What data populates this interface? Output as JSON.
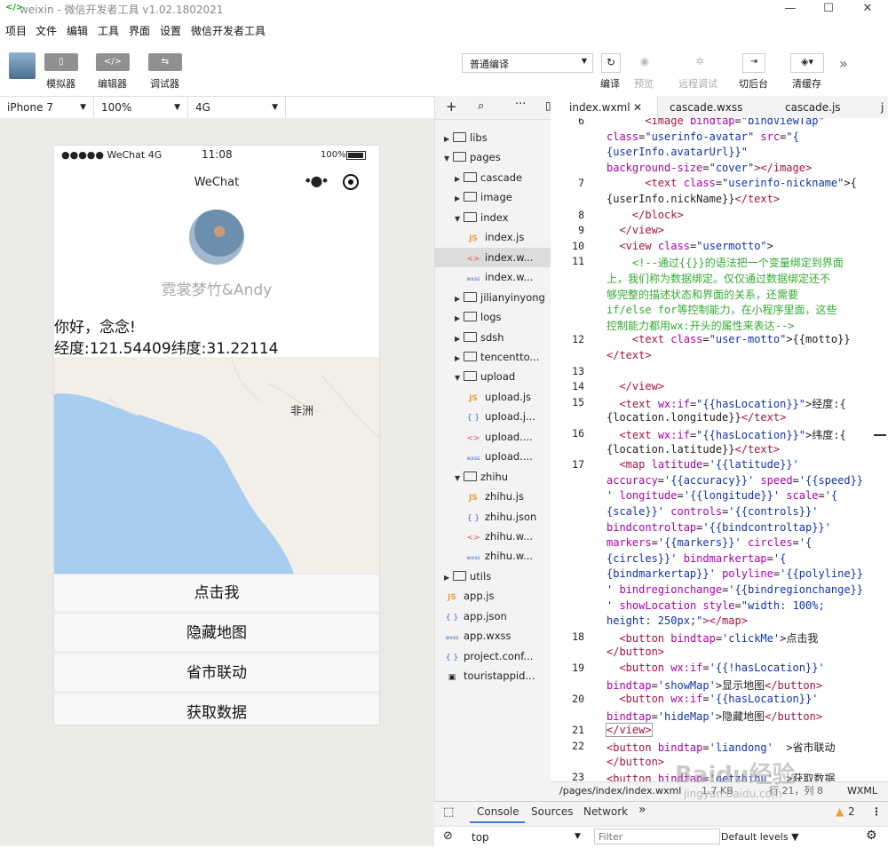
{
  "window": {
    "title": "weixin - 微信开发者工具 v1.02.1802021"
  },
  "menu": [
    "项目",
    "文件",
    "编辑",
    "工具",
    "界面",
    "设置",
    "微信开发者工具"
  ],
  "toolbar": {
    "simulator": "模拟器",
    "editor": "编辑器",
    "debugger": "调试器",
    "compile_mode": "普通编译",
    "compile": "编译",
    "preview": "预览",
    "remote_debug": "远程调试",
    "background": "切后台",
    "clear_cache": "清缓存"
  },
  "device": {
    "model": "iPhone 7",
    "zoom": "100%",
    "network": "4G"
  },
  "phone": {
    "status": {
      "carrier": "●●●●● WeChat 4G",
      "time": "11:08",
      "battery": "100%"
    },
    "nav_title": "WeChat",
    "nickname": "霓裳梦竹&Andy",
    "motto": "你好，念念!",
    "location": "经度:121.54409纬度:31.22114",
    "map_label": "非洲",
    "buttons": [
      "点击我",
      "隐藏地图",
      "省市联动",
      "获取数据"
    ]
  },
  "filetree": [
    {
      "depth": 0,
      "type": "folder",
      "open": false,
      "name": "libs"
    },
    {
      "depth": 0,
      "type": "folder",
      "open": true,
      "name": "pages"
    },
    {
      "depth": 1,
      "type": "folder",
      "open": false,
      "name": "cascade"
    },
    {
      "depth": 1,
      "type": "folder",
      "open": false,
      "name": "image"
    },
    {
      "depth": 1,
      "type": "folder",
      "open": true,
      "name": "index"
    },
    {
      "depth": 2,
      "type": "js",
      "name": "index.js"
    },
    {
      "depth": 2,
      "type": "xml",
      "name": "index.w...",
      "selected": true
    },
    {
      "depth": 2,
      "type": "wxss",
      "name": "index.w..."
    },
    {
      "depth": 1,
      "type": "folder",
      "open": false,
      "name": "jilianyinyong"
    },
    {
      "depth": 1,
      "type": "folder",
      "open": false,
      "name": "logs"
    },
    {
      "depth": 1,
      "type": "folder",
      "open": false,
      "name": "sdsh"
    },
    {
      "depth": 1,
      "type": "folder",
      "open": false,
      "name": "tencentto..."
    },
    {
      "depth": 1,
      "type": "folder",
      "open": true,
      "name": "upload"
    },
    {
      "depth": 2,
      "type": "js",
      "name": "upload.js"
    },
    {
      "depth": 2,
      "type": "json",
      "name": "upload.j..."
    },
    {
      "depth": 2,
      "type": "xml",
      "name": "upload...."
    },
    {
      "depth": 2,
      "type": "wxss",
      "name": "upload...."
    },
    {
      "depth": 1,
      "type": "folder",
      "open": true,
      "name": "zhihu"
    },
    {
      "depth": 2,
      "type": "js",
      "name": "zhihu.js"
    },
    {
      "depth": 2,
      "type": "json",
      "name": "zhihu.json"
    },
    {
      "depth": 2,
      "type": "xml",
      "name": "zhihu.w..."
    },
    {
      "depth": 2,
      "type": "wxss",
      "name": "zhihu.w..."
    },
    {
      "depth": 0,
      "type": "folder",
      "open": false,
      "name": "utils"
    },
    {
      "depth": 0,
      "type": "js",
      "name": "app.js"
    },
    {
      "depth": 0,
      "type": "json",
      "name": "app.json"
    },
    {
      "depth": 0,
      "type": "wxss",
      "name": "app.wxss"
    },
    {
      "depth": 0,
      "type": "json",
      "name": "project.conf..."
    },
    {
      "depth": 0,
      "type": "img",
      "name": "touristappid..."
    }
  ],
  "icon_labels": {
    "js": "JS",
    "xml": "<>",
    "wxss": "wxss",
    "json": "{ }",
    "img": "▣"
  },
  "tabs": [
    "index.wxml",
    "cascade.wxss",
    "cascade.js",
    "j"
  ],
  "code_lines": [
    {
      "n": "6",
      "html": "      <span class=\"tg\">&lt;image</span> <span class=\"at\">bindtap</span>=<span class=\"st\">\"bindViewTap\"</span>"
    },
    {
      "n": "",
      "html": "<span class=\"at\">class</span>=<span class=\"st\">\"userinfo-avatar\"</span> <span class=\"at\">src</span>=<span class=\"st\">\"{</span>"
    },
    {
      "n": "",
      "html": "<span class=\"st\">{userInfo.avatarUrl}}\"</span>"
    },
    {
      "n": "",
      "html": "<span class=\"at\">background-size</span>=<span class=\"st\">\"cover\"</span><span class=\"tg\">&gt;&lt;/image&gt;</span>"
    },
    {
      "n": "7",
      "html": "      <span class=\"tg\">&lt;text</span> <span class=\"at\">class</span>=<span class=\"st\">\"userinfo-nickname\"</span>&gt;{"
    },
    {
      "n": "",
      "html": "{userInfo.nickName}}<span class=\"tg\">&lt;/text&gt;</span>"
    },
    {
      "n": "8",
      "html": "    <span class=\"tg\">&lt;/block&gt;</span>"
    },
    {
      "n": "9",
      "html": "  <span class=\"tg\">&lt;/view&gt;</span>"
    },
    {
      "n": "10",
      "html": "  <span class=\"tg\">&lt;view</span> <span class=\"at\">class</span>=<span class=\"st\">\"usermotto\"</span>&gt;"
    },
    {
      "n": "11",
      "html": "    <span class=\"cm\">&lt;!--通过{{}}的语法把一个变量绑定到界面</span>"
    },
    {
      "n": "",
      "html": "<span class=\"cm\">上，我们称为数据绑定。仅仅通过数据绑定还不</span>"
    },
    {
      "n": "",
      "html": "<span class=\"cm\">够完整的描述状态和界面的关系，还需要</span>"
    },
    {
      "n": "",
      "html": "<span class=\"cm\">if/else for等控制能力，在小程序里面，这些</span>"
    },
    {
      "n": "",
      "html": "<span class=\"cm\">控制能力都用wx:开头的属性来表达--&gt;</span>"
    },
    {
      "n": "12",
      "html": "    <span class=\"tg\">&lt;text</span> <span class=\"at\">class</span>=<span class=\"st\">\"user-motto\"</span>&gt;{{motto}}"
    },
    {
      "n": "",
      "html": "<span class=\"tg\">&lt;/text&gt;</span>"
    },
    {
      "n": "13",
      "html": ""
    },
    {
      "n": "14",
      "html": "  <span class=\"tg\">&lt;/view&gt;</span>"
    },
    {
      "n": "15",
      "html": "  <span class=\"tg\">&lt;text</span> <span class=\"at\">wx:if</span>=<span class=\"st\">\"{{hasLocation}}\"</span>&gt;经度:{"
    },
    {
      "n": "",
      "html": "{location.longitude}}<span class=\"tg\">&lt;/text&gt;</span>"
    },
    {
      "n": "16",
      "html": "  <span class=\"tg\">&lt;text</span> <span class=\"at\">wx:if</span>=<span class=\"st\">\"{{hasLocation}}\"</span>&gt;纬度:{"
    },
    {
      "n": "",
      "html": "{location.latitude}}<span class=\"tg\">&lt;/text&gt;</span>"
    },
    {
      "n": "17",
      "html": "  <span class=\"tg\">&lt;map</span> <span class=\"at\">latitude</span>=<span class=\"st\">'{{latitude}}'</span>"
    },
    {
      "n": "",
      "html": "<span class=\"at\">accuracy</span>=<span class=\"st\">'{{accuracy}}'</span> <span class=\"at\">speed</span>=<span class=\"st\">'{{speed}}</span>"
    },
    {
      "n": "",
      "html": "<span class=\"st\">'</span> <span class=\"at\">longitude</span>=<span class=\"st\">'{{longitude}}'</span> <span class=\"at\">scale</span>=<span class=\"st\">'{</span>"
    },
    {
      "n": "",
      "html": "<span class=\"st\">{scale}}'</span> <span class=\"at\">controls</span>=<span class=\"st\">'{{controls}}'</span>"
    },
    {
      "n": "",
      "html": "<span class=\"at\">bindcontroltap</span>=<span class=\"st\">'{{bindcontroltap}}'</span>"
    },
    {
      "n": "",
      "html": "<span class=\"at\">markers</span>=<span class=\"st\">'{{markers}}'</span> <span class=\"at\">circles</span>=<span class=\"st\">'{</span>"
    },
    {
      "n": "",
      "html": "<span class=\"st\">{circles}}'</span> <span class=\"at\">bindmarkertap</span>=<span class=\"st\">'{</span>"
    },
    {
      "n": "",
      "html": "<span class=\"st\">{bindmarkertap}}'</span> <span class=\"at\">polyline</span>=<span class=\"st\">'{{polyline}}</span>"
    },
    {
      "n": "",
      "html": "<span class=\"st\">'</span> <span class=\"at\">bindregionchange</span>=<span class=\"st\">'{{bindregionchange}}</span>"
    },
    {
      "n": "",
      "html": "<span class=\"st\">'</span> <span class=\"at\">showLocation</span> <span class=\"at\">style</span>=<span class=\"st\">\"width: 100%;</span>"
    },
    {
      "n": "",
      "html": "<span class=\"st\">height: 250px;\"</span><span class=\"tg\">&gt;&lt;/map&gt;</span>"
    },
    {
      "n": "18",
      "html": "  <span class=\"tg\">&lt;button</span> <span class=\"at\">bindtap</span>=<span class=\"st\">'clickMe'</span>&gt;点击我"
    },
    {
      "n": "",
      "html": "<span class=\"tg\">&lt;/button&gt;</span>"
    },
    {
      "n": "19",
      "html": "  <span class=\"tg\">&lt;button</span> <span class=\"at\">wx:if</span>=<span class=\"st\">'{{!hasLocation}}'</span>"
    },
    {
      "n": "",
      "html": "<span class=\"at\">bindtap</span>=<span class=\"st\">'showMap'</span>&gt;显示地图<span class=\"tg\">&lt;/button&gt;</span>"
    },
    {
      "n": "20",
      "html": "  <span class=\"tg\">&lt;button</span> <span class=\"at\">wx:if</span>=<span class=\"st\">'{{hasLocation}}'</span>"
    },
    {
      "n": "",
      "html": "<span class=\"at\">bindtap</span>=<span class=\"st\">'hideMap'</span>&gt;隐藏地图<span class=\"tg\">&lt;/button&gt;</span>"
    },
    {
      "n": "21",
      "html": "<span class=\"tg\" style=\"outline:1px solid #999\">&lt;/view&gt;</span>"
    },
    {
      "n": "22",
      "html": "<span class=\"tg\">&lt;button</span> <span class=\"at\">bindtap</span>=<span class=\"st\">'liandong'</span>  &gt;省市联动"
    },
    {
      "n": "",
      "html": "<span class=\"tg\">&lt;/button&gt;</span>"
    },
    {
      "n": "23",
      "html": "<span class=\"tg\">&lt;button</span> <span class=\"at\">bindtap</span>=<span class=\"st\">'getzhihu'</span>  &gt;获取数据"
    }
  ],
  "editor_status": {
    "path": "/pages/index/index.wxml",
    "size": "1.7 KB",
    "pos": "行 21，列 8",
    "lang": "WXML"
  },
  "console": {
    "tabs": [
      "Console",
      "Sources",
      "Network"
    ],
    "more": "»",
    "warnings": "2",
    "context": "top",
    "filter_placeholder": "Filter",
    "levels": "Default levels ▼"
  },
  "watermark": "Baidu经验",
  "watermark_sub": "jingyan.baidu.com"
}
